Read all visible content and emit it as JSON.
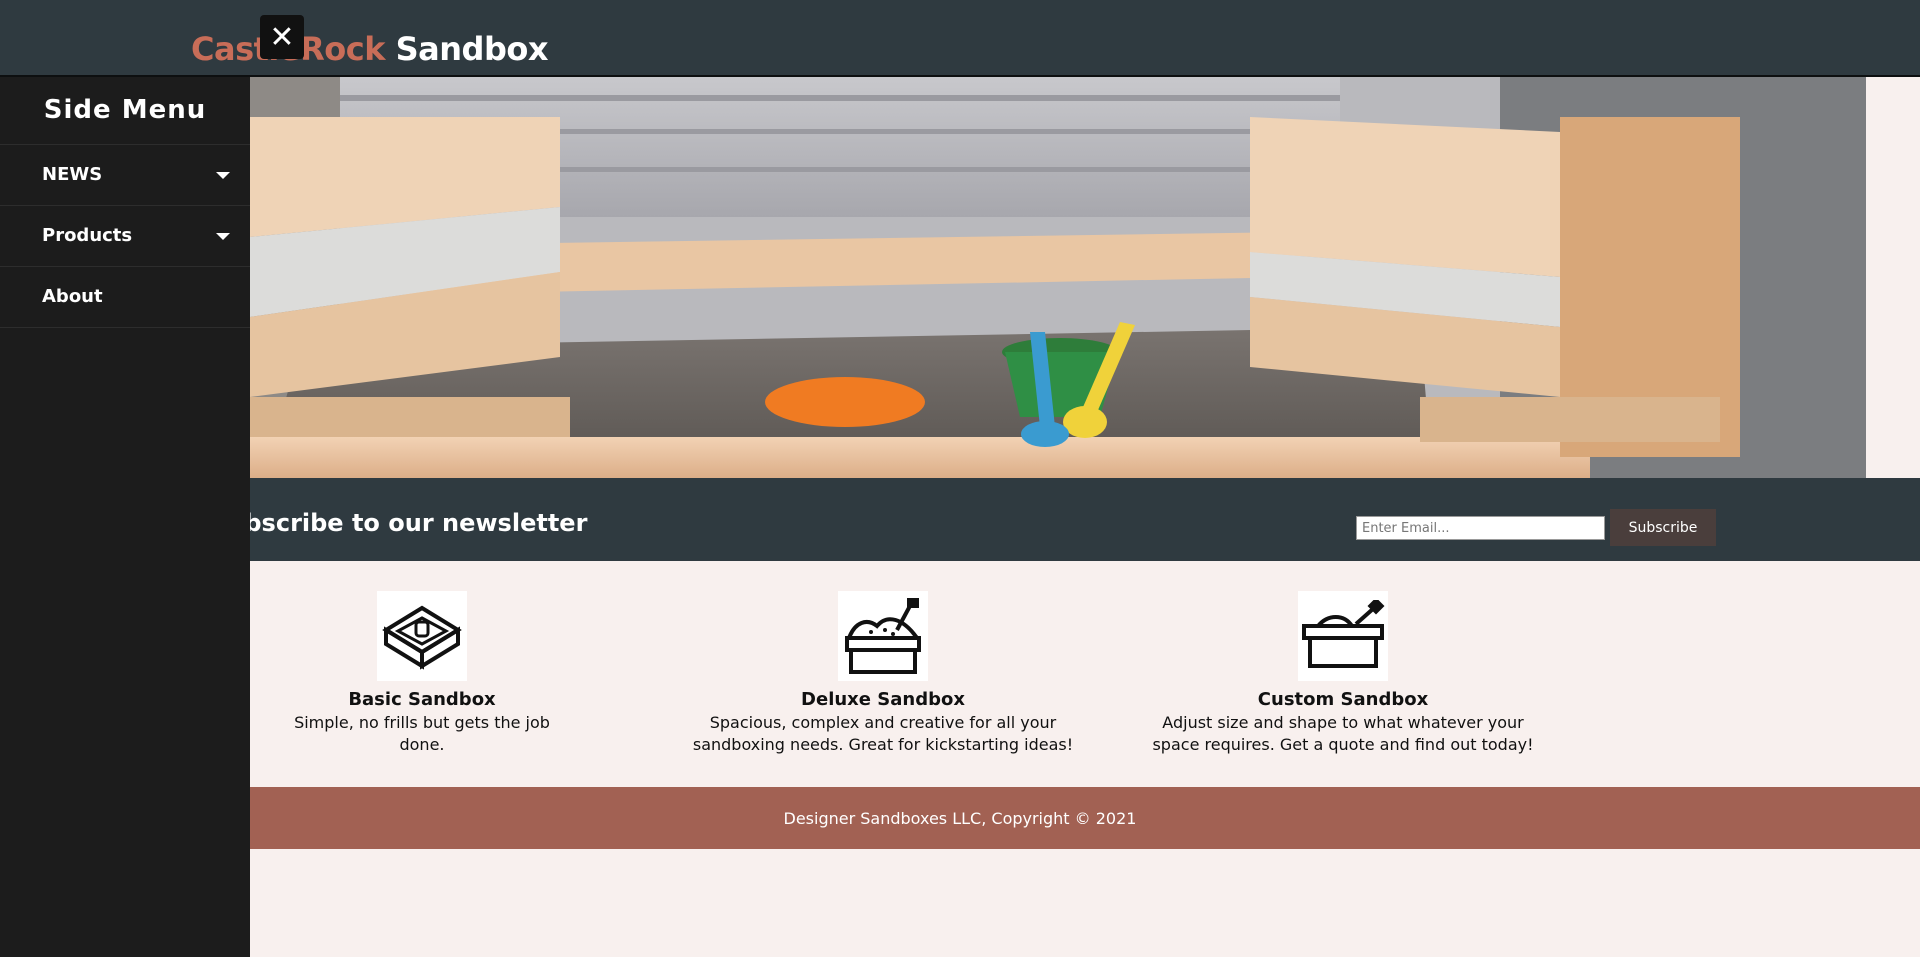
{
  "header": {
    "brand_part1": "CastleRock",
    "brand_part2": "Sandbox"
  },
  "side_menu": {
    "title": "Side Menu",
    "close_icon": "close-icon",
    "items": [
      {
        "label": "NEWS",
        "has_dropdown": true
      },
      {
        "label": "Products",
        "has_dropdown": true
      },
      {
        "label": "About",
        "has_dropdown": false
      }
    ]
  },
  "newsletter": {
    "title": "Subscribe to our newsletter",
    "email_placeholder": "Enter Email...",
    "subscribe_label": "Subscribe"
  },
  "products": [
    {
      "icon": "sandbox-bucket-icon",
      "title": "Basic Sandbox",
      "desc": "Simple, no frills but gets the job done."
    },
    {
      "icon": "sandbox-shovel-icon",
      "title": "Deluxe Sandbox",
      "desc": "Spacious, complex and creative for all your sandboxing needs. Great for kickstarting ideas!"
    },
    {
      "icon": "custom-sandbox-icon",
      "title": "Custom Sandbox",
      "desc": "Adjust size and shape to what whatever your space requires. Get a quote and find out today!"
    }
  ],
  "footer": {
    "text": "Designer Sandboxes LLC, Copyright © 2021"
  },
  "colors": {
    "header_bg": "#2f3a40",
    "brand_accent": "#c86d58",
    "sidemenu_bg": "#1c1c1c",
    "footer_bg": "#a26153",
    "page_bg": "#f8f0ee"
  }
}
